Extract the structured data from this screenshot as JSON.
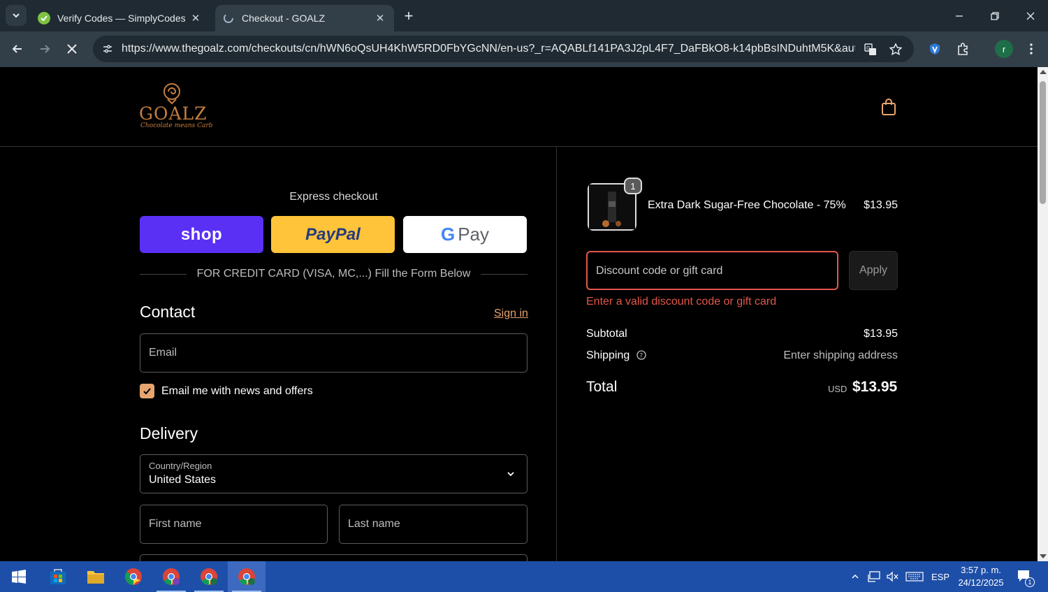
{
  "browser": {
    "tabs": [
      {
        "title": "Verify Codes — SimplyCodes",
        "active": false
      },
      {
        "title": "Checkout - GOALZ",
        "active": true
      }
    ],
    "url": "https://www.thegoalz.com/checkouts/cn/hWN6oQsUH4KhW5RD0FbYGcNN/en-us?_r=AQABLf141PA3J2pL4F7_DaFBkO8-k14pbBsINDuhtM5K&auto_redi...",
    "profile_initial": "r"
  },
  "store": {
    "logo_text": "GOALZ",
    "logo_tagline": "Chocolate means Carb"
  },
  "checkout": {
    "express_title": "Express checkout",
    "shop_label": "shop",
    "paypal_label": "PayPal",
    "gpay_label": "Pay",
    "gpay_g": "G",
    "divider_text": "FOR CREDIT CARD (VISA, MC,...) Fill the Form Below",
    "contact_heading": "Contact",
    "signin_label": "Sign in",
    "email_placeholder": "Email",
    "newsletter_label": "Email me with news and offers",
    "newsletter_checked": true,
    "delivery_heading": "Delivery",
    "country_label": "Country/Region",
    "country_value": "United States",
    "first_name_placeholder": "First name",
    "last_name_placeholder": "Last name"
  },
  "summary": {
    "item": {
      "name": "Extra Dark Sugar-Free Chocolate - 75%",
      "price": "$13.95",
      "quantity": "1"
    },
    "discount_placeholder": "Discount code or gift card",
    "apply_label": "Apply",
    "error_text": "Enter a valid discount code or gift card",
    "subtotal_label": "Subtotal",
    "subtotal_value": "$13.95",
    "shipping_label": "Shipping",
    "shipping_value": "Enter shipping address",
    "total_label": "Total",
    "total_currency": "USD",
    "total_value": "$13.95"
  },
  "taskbar": {
    "language": "ESP",
    "time": "3:57 p. m.",
    "date": "24/12/2025",
    "notification_count": "1"
  },
  "colors": {
    "accent": "#e7a46f",
    "error": "#e2574c",
    "shop_purple": "#5a31f4",
    "paypal_yellow": "#ffc439",
    "logo_gold": "#c57f3f"
  }
}
